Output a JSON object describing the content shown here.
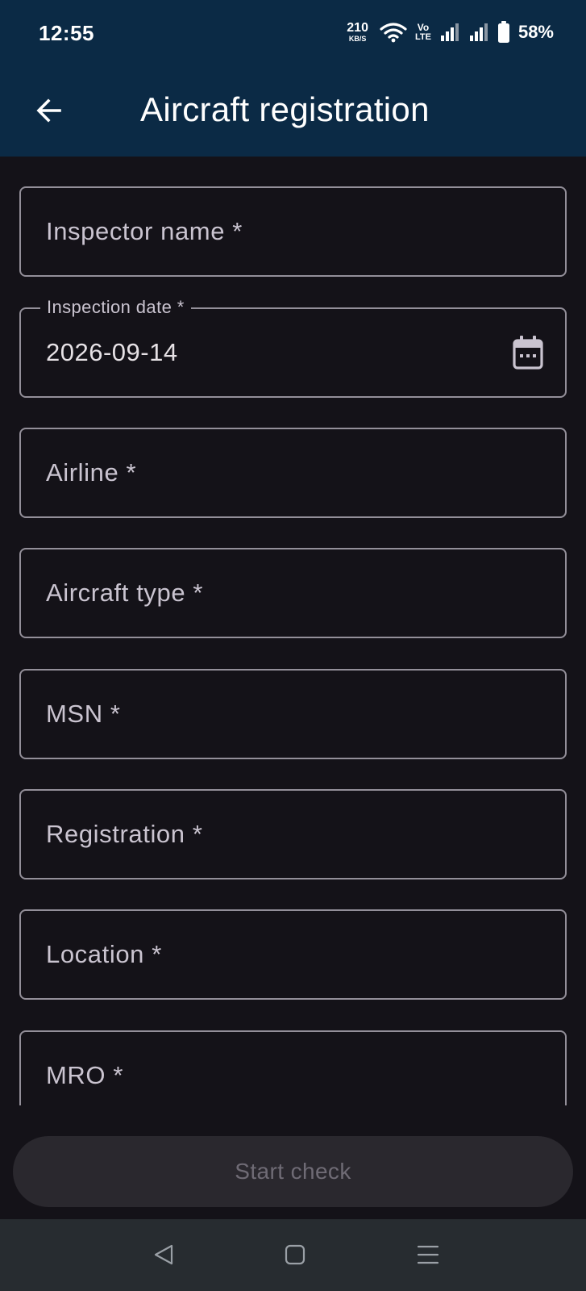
{
  "status_bar": {
    "time": "12:55",
    "net_speed_value": "210",
    "net_speed_unit": "KB/S",
    "volte_top": "Vo",
    "volte_bottom": "LTE",
    "battery_percent": "58%"
  },
  "app_bar": {
    "title": "Aircraft registration",
    "back_icon": "arrow-left-icon"
  },
  "form": {
    "inspector_name": {
      "placeholder": "Inspector name *"
    },
    "inspection_date": {
      "label": "Inspection date *",
      "value": "2026-09-14",
      "icon": "calendar-icon"
    },
    "airline": {
      "placeholder": "Airline *"
    },
    "aircraft_type": {
      "placeholder": "Aircraft type *"
    },
    "msn": {
      "placeholder": "MSN *"
    },
    "registration": {
      "placeholder": "Registration *"
    },
    "location": {
      "placeholder": "Location *"
    },
    "mro": {
      "placeholder": "MRO *"
    }
  },
  "actions": {
    "start_check_label": "Start check",
    "start_check_enabled": false
  },
  "colors": {
    "app_bar_bg": "#0b2a45",
    "page_bg": "#141218",
    "field_border": "#938f99",
    "button_bg": "#2a282e",
    "button_text": "#6f6b75",
    "nav_bar_bg": "#272c30"
  },
  "nav_bar": {
    "back_icon": "triangle-back-icon",
    "home_icon": "square-home-icon",
    "recents_icon": "menu-lines-icon"
  }
}
